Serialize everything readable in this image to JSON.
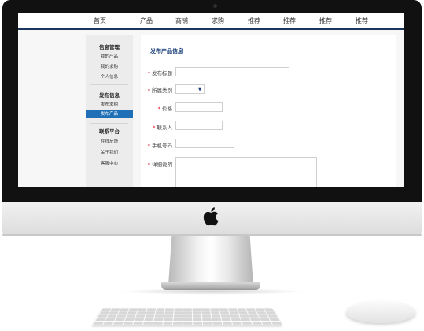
{
  "nav": {
    "items": [
      "首页",
      "产品",
      "商铺",
      "求购",
      "推荐",
      "推荐",
      "推荐",
      "推荐"
    ]
  },
  "sidebar": {
    "sections": [
      {
        "title": "信息管理",
        "items": [
          "我的产品",
          "我的求购",
          "个人信息"
        ]
      },
      {
        "title": "发布信息",
        "items": [
          "发布求购",
          "发布产品"
        ],
        "active": "发布产品"
      },
      {
        "title": "联系平台",
        "items": [
          "在线反馈",
          "关于我们",
          "客服中心"
        ]
      }
    ]
  },
  "form": {
    "title": "发布产品信息",
    "fields": {
      "title_label": "发布标题",
      "category_label": "所属类别",
      "price_label": "价格",
      "contact_label": "联系人",
      "phone_label": "手机号码",
      "details_label": "详细说明"
    },
    "required_mark": "*"
  },
  "colors": {
    "accent": "#1a3f7a",
    "active": "#1f6fb6",
    "required": "#d9001b"
  },
  "icons": {
    "apple": "apple-logo",
    "dropdown": "triangle-down"
  }
}
